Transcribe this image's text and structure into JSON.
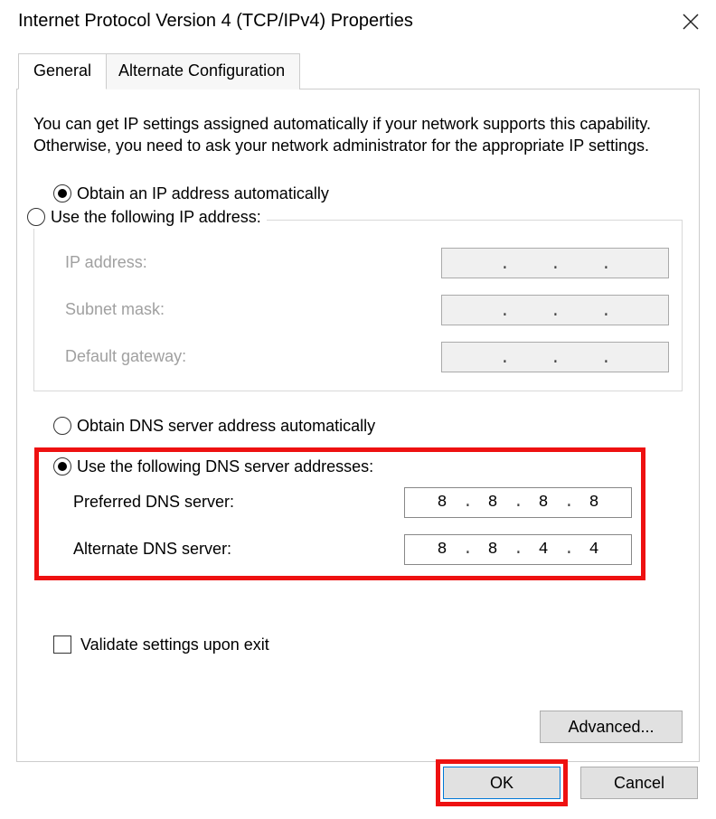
{
  "window": {
    "title": "Internet Protocol Version 4 (TCP/IPv4) Properties"
  },
  "tabs": {
    "general": "General",
    "alternate": "Alternate Configuration"
  },
  "intro": "You can get IP settings assigned automatically if your network supports this capability. Otherwise, you need to ask your network administrator for the appropriate IP settings.",
  "ip": {
    "auto_label": "Obtain an IP address automatically",
    "manual_label": "Use the following IP address:",
    "ip_label": "IP address:",
    "subnet_label": "Subnet mask:",
    "gateway_label": "Default gateway:",
    "ip_value": [
      "",
      "",
      "",
      ""
    ],
    "subnet_value": [
      "",
      "",
      "",
      ""
    ],
    "gateway_value": [
      "",
      "",
      "",
      ""
    ]
  },
  "dns": {
    "auto_label": "Obtain DNS server address automatically",
    "manual_label": "Use the following DNS server addresses:",
    "preferred_label": "Preferred DNS server:",
    "alternate_label": "Alternate DNS server:",
    "preferred_value": [
      "8",
      "8",
      "8",
      "8"
    ],
    "alternate_value": [
      "8",
      "8",
      "4",
      "4"
    ]
  },
  "validate_label": "Validate settings upon exit",
  "buttons": {
    "advanced": "Advanced...",
    "ok": "OK",
    "cancel": "Cancel"
  }
}
